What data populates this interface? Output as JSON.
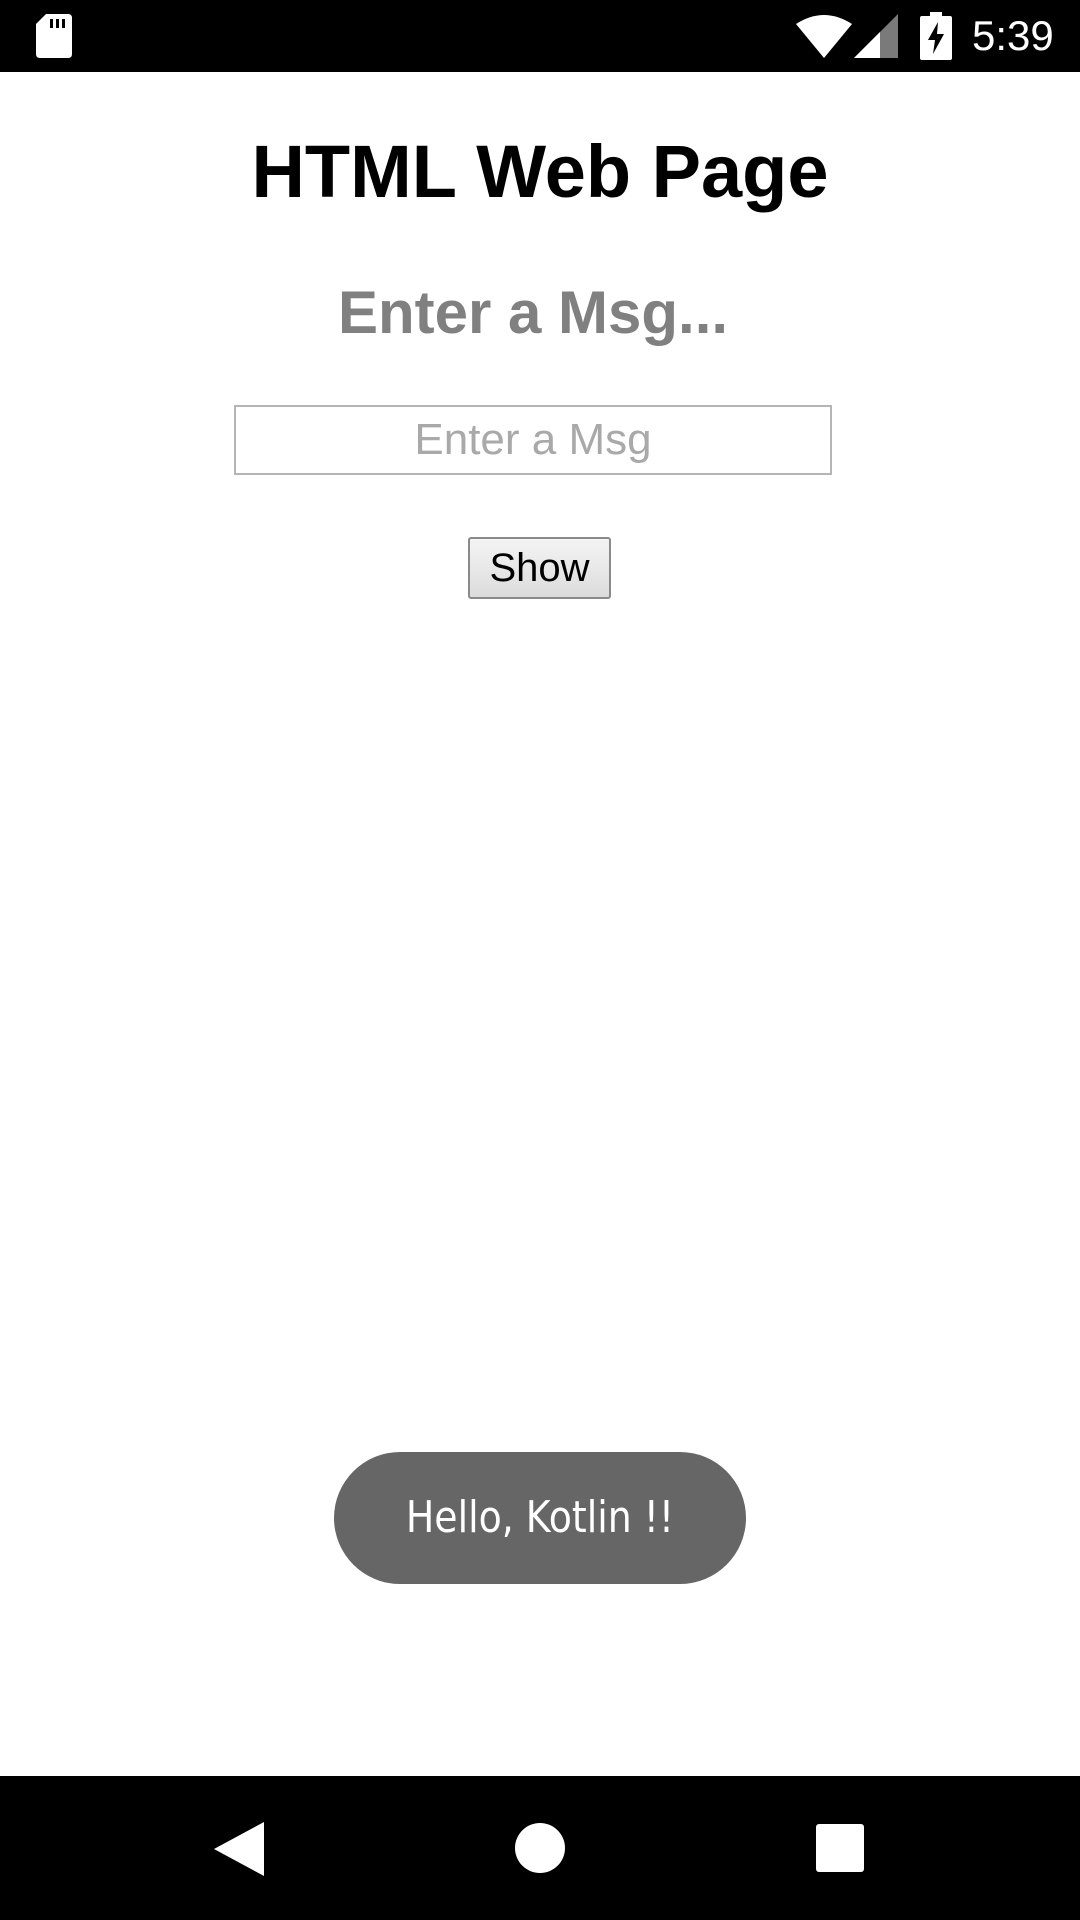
{
  "status_bar": {
    "time": "5:39",
    "icons": [
      "sd-card-icon",
      "wifi-icon",
      "cell-signal-icon",
      "battery-charging-icon"
    ]
  },
  "page": {
    "title": "HTML Web Page",
    "heading": "Enter a Msg...",
    "input": {
      "placeholder": "Enter a Msg",
      "value": ""
    },
    "show_button_label": "Show"
  },
  "toast": {
    "text": "Hello, Kotlin !!"
  },
  "nav_bar": {
    "icons": [
      "back-icon",
      "home-icon",
      "recents-icon"
    ]
  },
  "colors": {
    "heading_gray": "#808080",
    "toast_bg": "#666666",
    "system_bar": "#000000"
  }
}
